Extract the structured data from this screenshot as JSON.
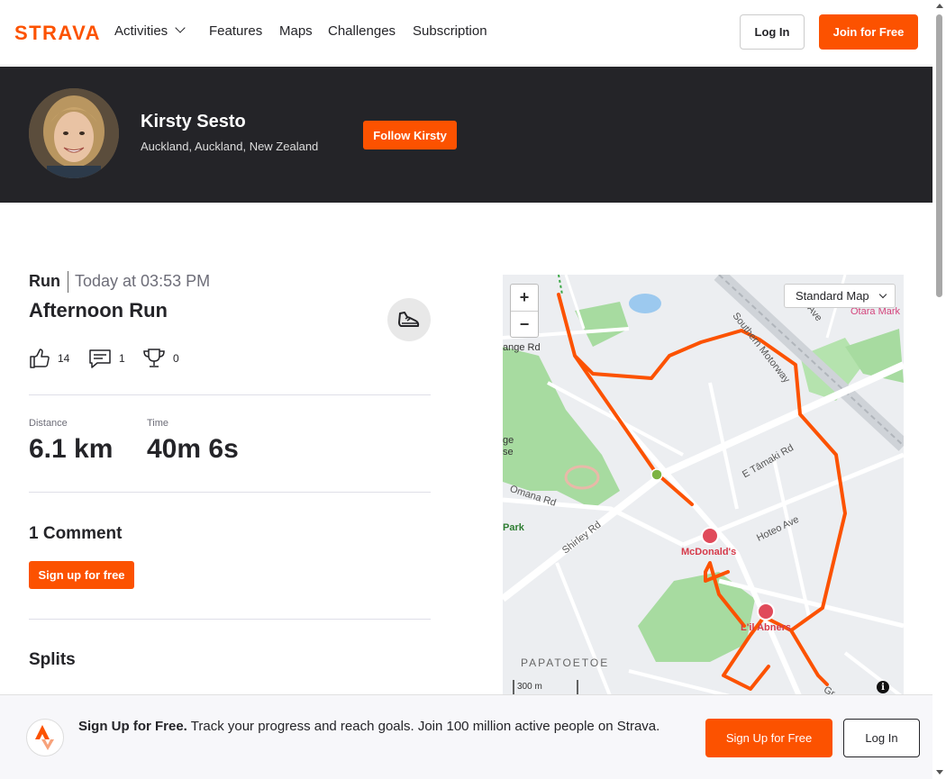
{
  "nav": {
    "brand": "STRAVA",
    "items": [
      "Activities",
      "Features",
      "Maps",
      "Challenges",
      "Subscription"
    ],
    "login_label": "Log In",
    "join_label": "Join for Free"
  },
  "athlete": {
    "name": "Kirsty Sesto",
    "location": "Auckland, Auckland, New Zealand",
    "follow_label": "Follow Kirsty"
  },
  "activity": {
    "type": "Run",
    "datetime": "Today at 03:53 PM",
    "title": "Afternoon Run",
    "kudos_count": "14",
    "comment_count": "1",
    "achievement_count": "0",
    "stats": [
      {
        "label": "Distance",
        "value": "6.1 km"
      },
      {
        "label": "Time",
        "value": "40m 6s"
      }
    ]
  },
  "comments": {
    "title": "1 Comment",
    "signup_label": "Sign up for free"
  },
  "splits": {
    "title": "Splits"
  },
  "map": {
    "style_label": "Standard Map",
    "zoom_in": "+",
    "zoom_out": "−",
    "scale": "300 m",
    "info": "i",
    "labels": {
      "motorway": "Southern Motorway",
      "ave": "Ave",
      "otara": "Otara Mark",
      "grange": "ange Rd",
      "ge": "ge",
      "se": "se",
      "omana": "Omana Rd",
      "park": "Park",
      "shirley": "Shirley Rd",
      "tamaki": "E Tāmaki Rd",
      "hoteo": "Hoteo Ave",
      "mcdonalds": "McDonald's",
      "lil_abners": "L'il Abners",
      "papatoetoe": "PAPATOETOE",
      "gr": "Gr"
    },
    "route_color": "#fc5200"
  },
  "banner": {
    "headline": "Sign Up for Free.",
    "text": "Track your progress and reach goals. Join 100 million active people on Strava.",
    "signup_label": "Sign Up for Free",
    "login_label": "Log In"
  },
  "colors": {
    "brand": "#fc5200",
    "header_bg": "#242428"
  }
}
